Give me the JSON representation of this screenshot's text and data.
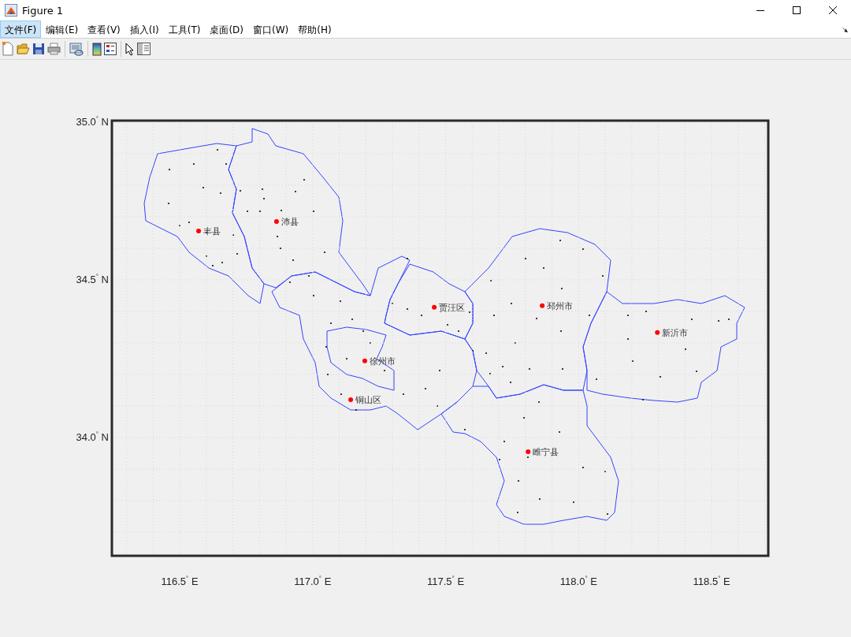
{
  "window": {
    "title": "Figure 1"
  },
  "menu": [
    {
      "label": "文件(F)",
      "selected": true
    },
    {
      "label": "编辑(E)",
      "selected": false
    },
    {
      "label": "查看(V)",
      "selected": false
    },
    {
      "label": "插入(I)",
      "selected": false
    },
    {
      "label": "工具(T)",
      "selected": false
    },
    {
      "label": "桌面(D)",
      "selected": false
    },
    {
      "label": "窗口(W)",
      "selected": false
    },
    {
      "label": "帮助(H)",
      "selected": false
    }
  ],
  "figure": {
    "chart_data": {
      "type": "scatter",
      "grid": true,
      "xlim": [
        116.245,
        118.713
      ],
      "ylim": [
        33.625,
        35.005
      ],
      "xticks": [
        {
          "value": 116.5,
          "label": "116.5$^{°}$ E"
        },
        {
          "value": 117.0,
          "label": "117.0$^{°}$ E"
        },
        {
          "value": 117.5,
          "label": "117.5$^{°}$ E"
        },
        {
          "value": 118.0,
          "label": "118.0$^{°}$ E"
        },
        {
          "value": 118.5,
          "label": "118.5$^{°}$ E"
        }
      ],
      "yticks": [
        {
          "value": 34.0,
          "label": "34.0$^{°}$ N"
        },
        {
          "value": 34.5,
          "label": "34.5$^{°}$ N"
        },
        {
          "value": 35.0,
          "label": "35.0$^{°}$ N"
        }
      ],
      "x": [
        116.571,
        116.864,
        117.457,
        117.863,
        118.296,
        117.196,
        117.143,
        117.81
      ],
      "series": [
        {
          "color": "#ff0000",
          "values": [
            34.655,
            34.685,
            34.413,
            34.418,
            34.333,
            34.243,
            34.12,
            33.955
          ]
        }
      ],
      "annotations": [
        {
          "text": "丰县",
          "x": 116.571,
          "y": 34.655
        },
        {
          "text": "沛县",
          "x": 116.864,
          "y": 34.685
        },
        {
          "text": "贾汪区",
          "x": 117.457,
          "y": 34.413
        },
        {
          "text": "邳州市",
          "x": 117.863,
          "y": 34.418
        },
        {
          "text": "新沂市",
          "x": 118.296,
          "y": 34.333
        },
        {
          "text": "徐州市",
          "x": 117.196,
          "y": 34.243
        },
        {
          "text": "铜山区",
          "x": 117.143,
          "y": 34.12
        },
        {
          "text": "睢宁县",
          "x": 117.81,
          "y": 33.955
        }
      ]
    }
  }
}
